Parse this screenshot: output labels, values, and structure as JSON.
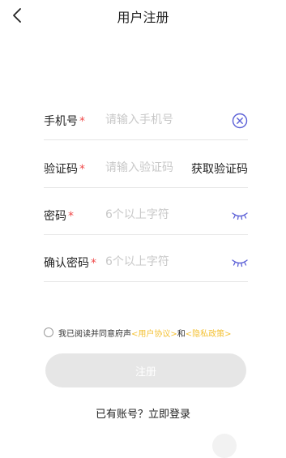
{
  "header": {
    "title": "用户注册",
    "back_icon": "chevron-left-icon"
  },
  "form": {
    "required_mark": "*",
    "phone": {
      "label": "手机号",
      "placeholder": "请输入手机号",
      "value": "",
      "clear_icon": "clear-circle-icon"
    },
    "code": {
      "label": "验证码",
      "placeholder": "请输入验证码",
      "value": "",
      "get_code_label": "获取验证码"
    },
    "password": {
      "label": "密码",
      "placeholder": "6个以上字符",
      "value": "",
      "toggle_icon": "eye-closed-icon"
    },
    "confirm": {
      "label": "确认密码",
      "placeholder": "6个以上字符",
      "value": "",
      "toggle_icon": "eye-closed-icon"
    }
  },
  "agreement": {
    "checked": false,
    "text": "我已阅读并同意府声",
    "user_agreement": "<用户协议>",
    "and": "和",
    "privacy_policy": "<隐私政策>"
  },
  "submit": {
    "label": "注册"
  },
  "login_link": "已有账号？立即登录",
  "colors": {
    "required": "#f04a4a",
    "icon_accent": "#5a5fd6",
    "link": "#f4c236",
    "button_disabled": "#e6e6e6",
    "divider": "#e5e5e5"
  }
}
